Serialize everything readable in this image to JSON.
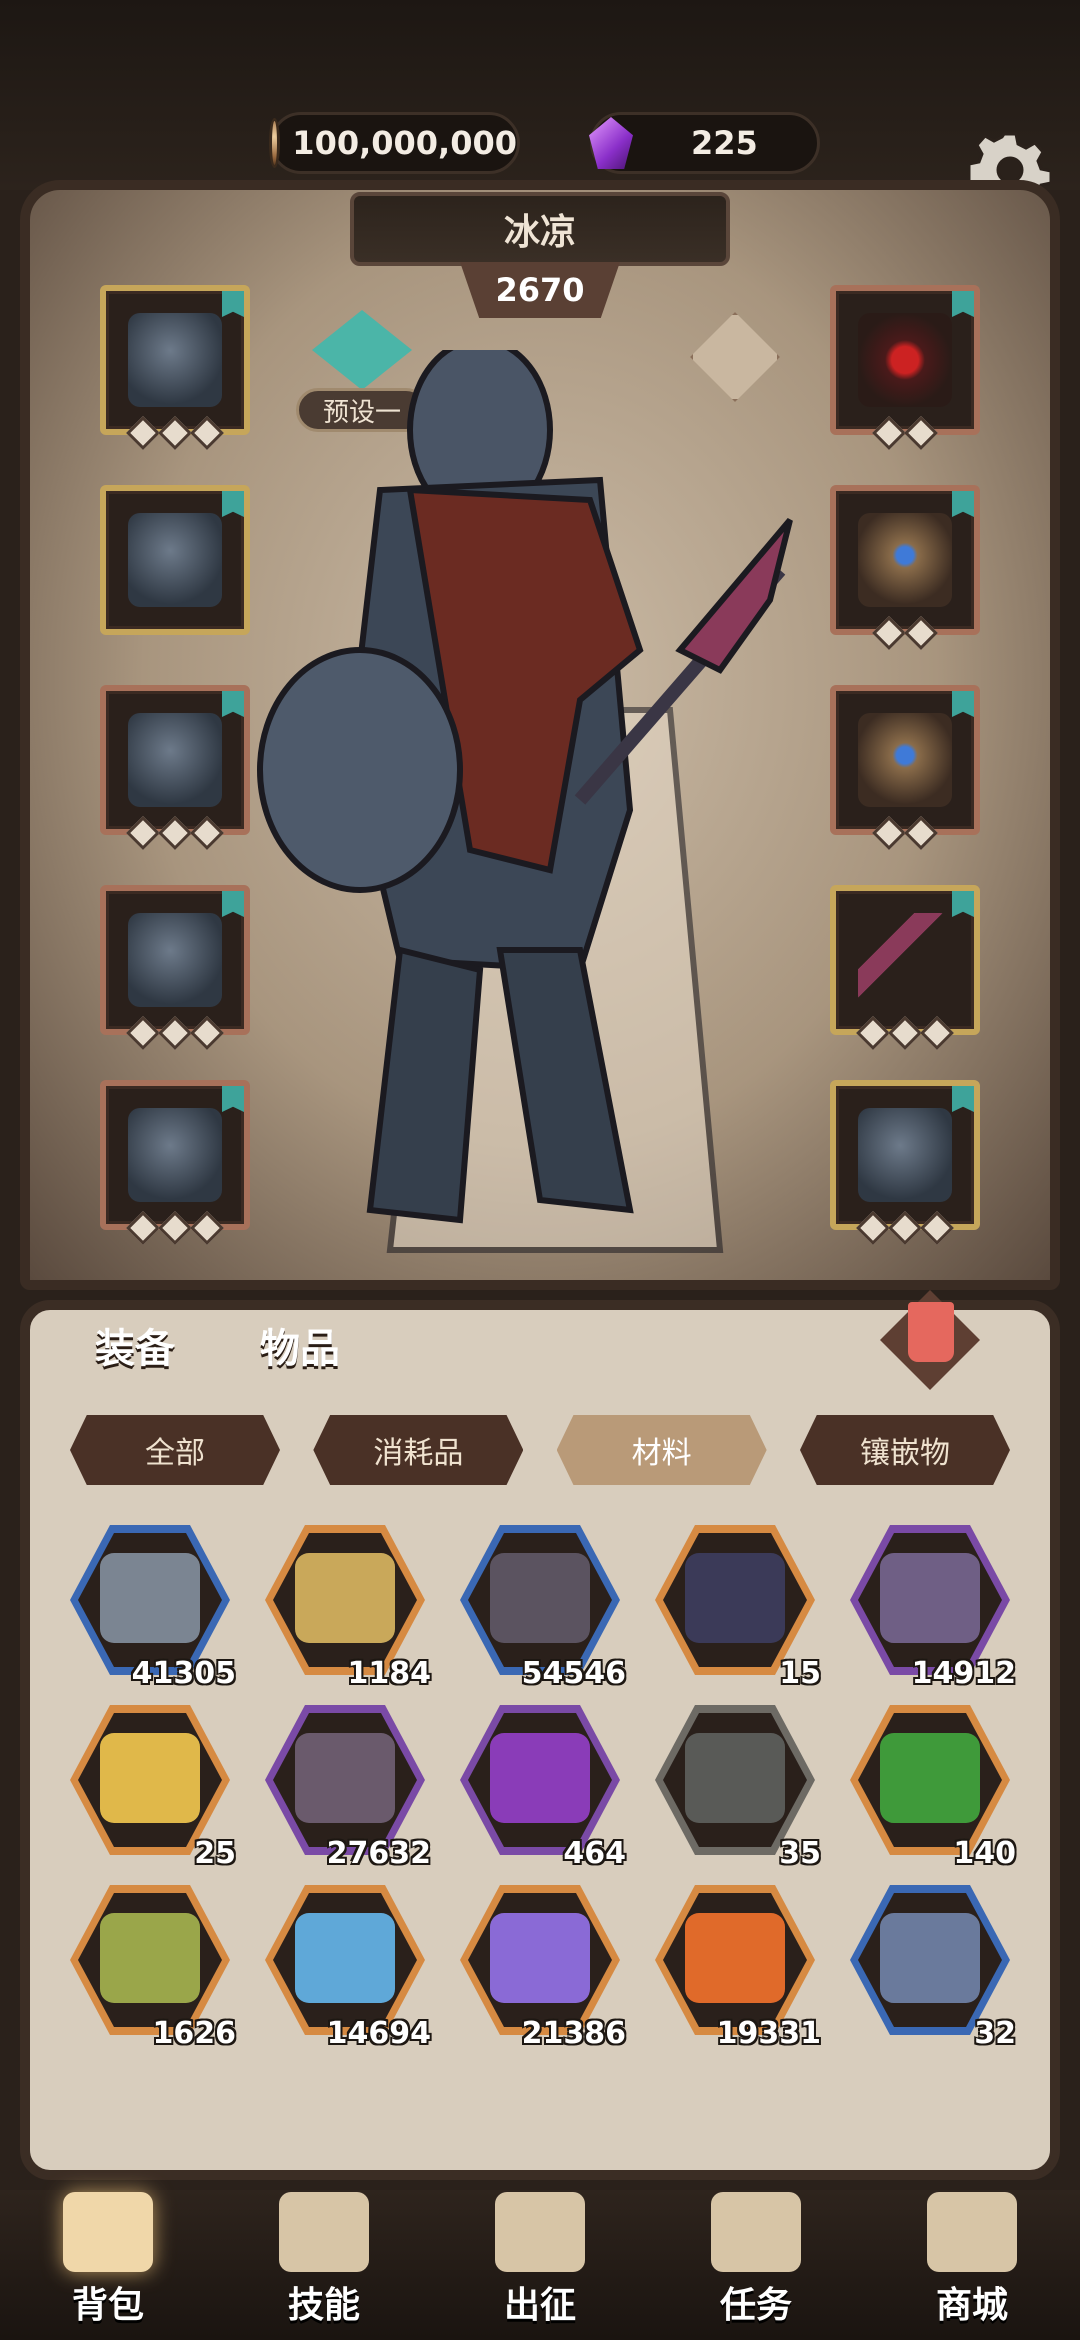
{
  "resources": {
    "coins": "100,000,000",
    "gems": "225"
  },
  "hero": {
    "name": "冰凉",
    "power": "2670",
    "preset_label": "预设一"
  },
  "main_tabs": {
    "equipment": "装备",
    "items": "物品"
  },
  "filters": [
    "全部",
    "消耗品",
    "材料",
    "镶嵌物"
  ],
  "active_filter": "材料",
  "items": [
    {
      "count": "41305",
      "frame": "blue",
      "icon": "iron-ore-icon",
      "color": "#7b8592"
    },
    {
      "count": "1184",
      "frame": "orange",
      "icon": "gold-ingot-icon",
      "color": "#c9a85a"
    },
    {
      "count": "54546",
      "frame": "blue",
      "icon": "dark-crystal-icon",
      "color": "#5b5360"
    },
    {
      "count": "15",
      "frame": "orange",
      "icon": "quill-icon",
      "color": "#3b3a58"
    },
    {
      "count": "14912",
      "frame": "purple",
      "icon": "mithril-ore-icon",
      "color": "#6f5f85"
    },
    {
      "count": "25",
      "frame": "orange",
      "icon": "yellow-potion-icon",
      "color": "#e0b84a"
    },
    {
      "count": "27632",
      "frame": "purple",
      "icon": "crystal-cluster-icon",
      "color": "#6a5a6c"
    },
    {
      "count": "464",
      "frame": "purple",
      "icon": "purple-potion-icon",
      "color": "#8a3cb8"
    },
    {
      "count": "35",
      "frame": "gray",
      "icon": "scroll-icon",
      "color": "#595a57"
    },
    {
      "count": "140",
      "frame": "orange",
      "icon": "emerald-ingot-icon",
      "color": "#3f9a3a"
    },
    {
      "count": "1626",
      "frame": "orange",
      "icon": "nature-rune-icon",
      "color": "#9aa64a"
    },
    {
      "count": "14694",
      "frame": "orange",
      "icon": "ice-rune-icon",
      "color": "#5fa8d8"
    },
    {
      "count": "21386",
      "frame": "orange",
      "icon": "lightning-rune-icon",
      "color": "#8a6ad6"
    },
    {
      "count": "19331",
      "frame": "orange",
      "icon": "fire-rune-icon",
      "color": "#e06a2a"
    },
    {
      "count": "32",
      "frame": "blue",
      "icon": "feather-gem-icon",
      "color": "#6a7a9c"
    }
  ],
  "nav": [
    {
      "label": "背包",
      "icon": "backpack-icon"
    },
    {
      "label": "技能",
      "icon": "skill-book-icon"
    },
    {
      "label": "出征",
      "icon": "sword-banner-icon"
    },
    {
      "label": "任务",
      "icon": "quest-icon"
    },
    {
      "label": "商城",
      "icon": "shop-icon"
    }
  ]
}
